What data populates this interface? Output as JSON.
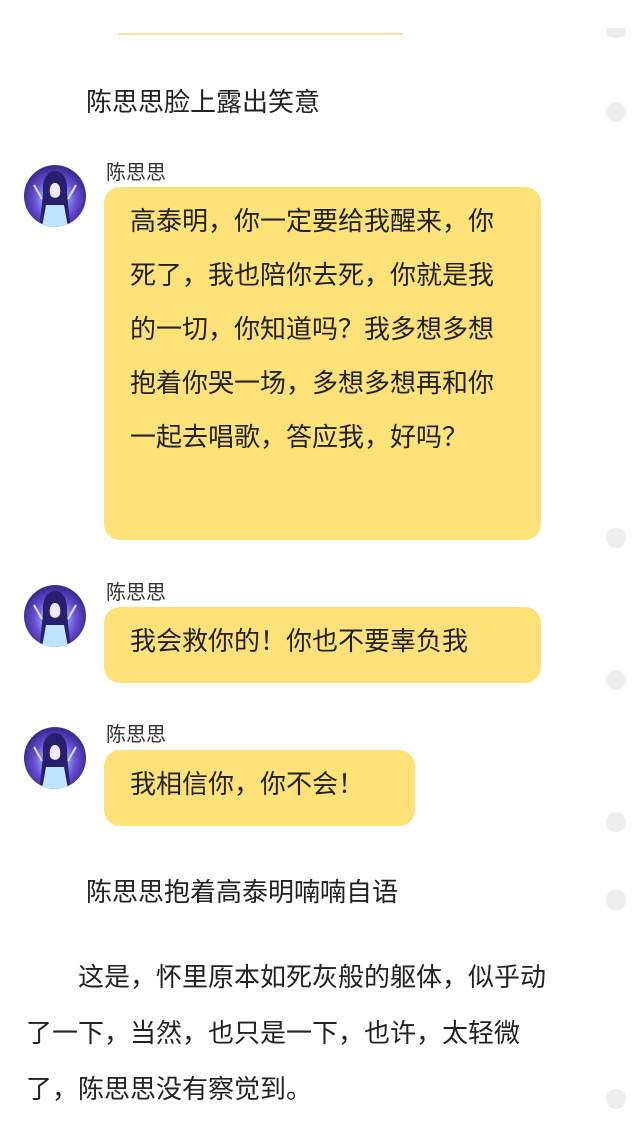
{
  "story": {
    "narration_1": "陈思思脸上露出笑意",
    "messages": [
      {
        "sender": "陈思思",
        "text": "高泰明，你一定要给我醒来，你死了，我也陪你去死，你就是我的一切，你知道吗？我多想多想抱着你哭一场，多想多想再和你一起去唱歌，答应我，好吗？"
      },
      {
        "sender": "陈思思",
        "text": "我会救你的！你也不要辜负我"
      },
      {
        "sender": "陈思思",
        "text": "我相信你，你不会！"
      }
    ],
    "narration_2": "陈思思抱着高泰明喃喃自语",
    "paragraph": "这是，怀里原本如死灰般的躯体，似乎动了一下，当然，也只是一下，也许，太轻微了，陈思思没有察觉到。"
  },
  "colors": {
    "bubble": "#fde27a",
    "side_dot": "#ededed",
    "divider": "#f3e6a6"
  },
  "icons": {
    "avatar": "anime-character-avatar-icon",
    "side_marker": "comment-dot-icon"
  }
}
